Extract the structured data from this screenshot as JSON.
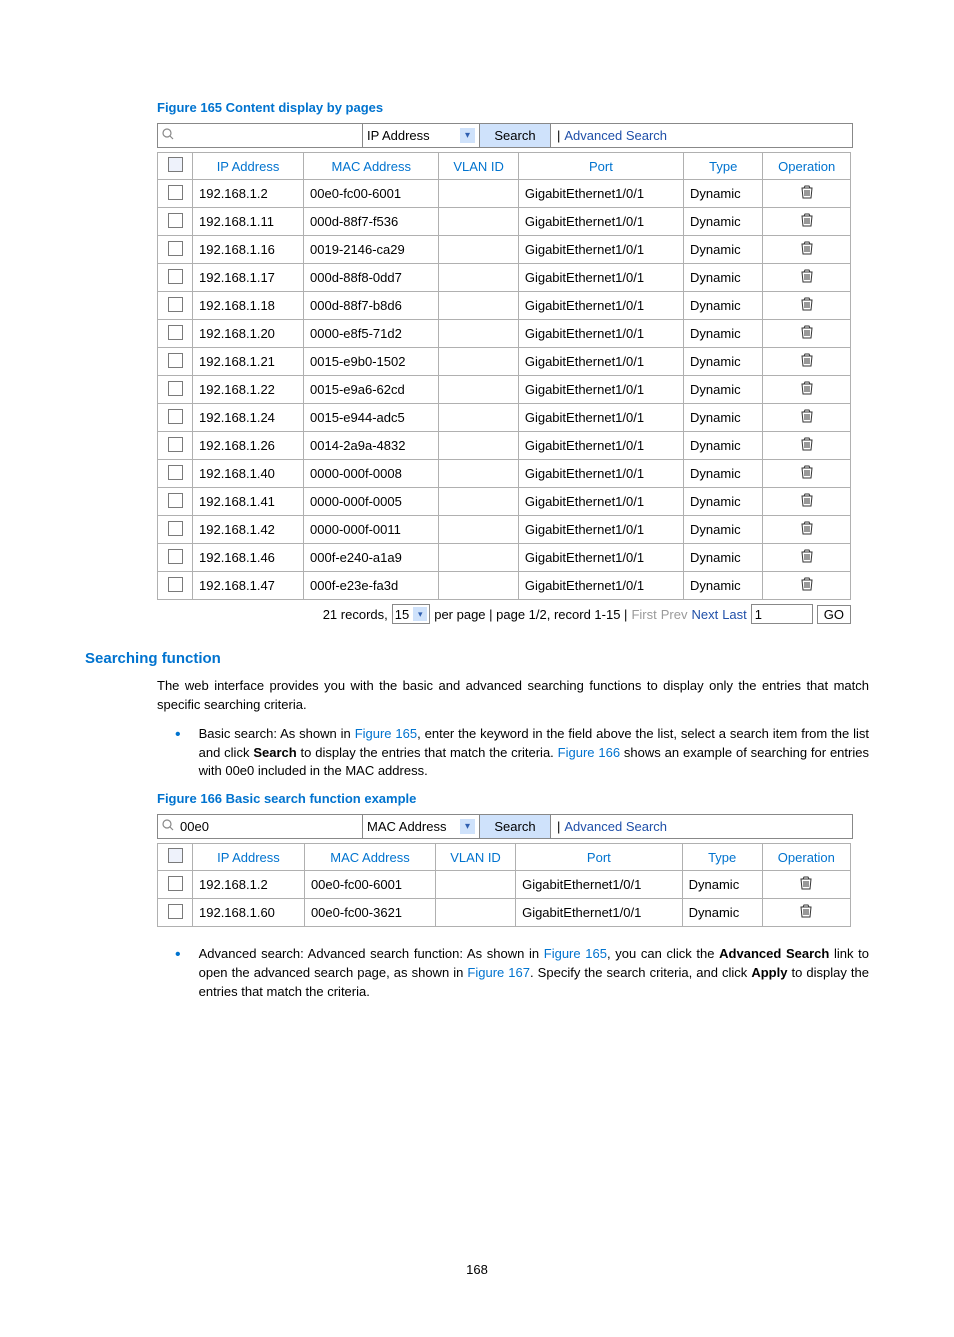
{
  "figure165": {
    "caption": "Figure 165 Content display by pages",
    "search": {
      "query": "",
      "select_label": "IP Address",
      "button": "Search",
      "advanced": "Advanced Search"
    },
    "headers": [
      "IP Address",
      "MAC Address",
      "VLAN ID",
      "Port",
      "Type",
      "Operation"
    ],
    "rows": [
      {
        "ip": "192.168.1.2",
        "mac": "00e0-fc00-6001",
        "vlan": "",
        "port": "GigabitEthernet1/0/1",
        "type": "Dynamic"
      },
      {
        "ip": "192.168.1.11",
        "mac": "000d-88f7-f536",
        "vlan": "",
        "port": "GigabitEthernet1/0/1",
        "type": "Dynamic"
      },
      {
        "ip": "192.168.1.16",
        "mac": "0019-2146-ca29",
        "vlan": "",
        "port": "GigabitEthernet1/0/1",
        "type": "Dynamic"
      },
      {
        "ip": "192.168.1.17",
        "mac": "000d-88f8-0dd7",
        "vlan": "",
        "port": "GigabitEthernet1/0/1",
        "type": "Dynamic"
      },
      {
        "ip": "192.168.1.18",
        "mac": "000d-88f7-b8d6",
        "vlan": "",
        "port": "GigabitEthernet1/0/1",
        "type": "Dynamic"
      },
      {
        "ip": "192.168.1.20",
        "mac": "0000-e8f5-71d2",
        "vlan": "",
        "port": "GigabitEthernet1/0/1",
        "type": "Dynamic"
      },
      {
        "ip": "192.168.1.21",
        "mac": "0015-e9b0-1502",
        "vlan": "",
        "port": "GigabitEthernet1/0/1",
        "type": "Dynamic"
      },
      {
        "ip": "192.168.1.22",
        "mac": "0015-e9a6-62cd",
        "vlan": "",
        "port": "GigabitEthernet1/0/1",
        "type": "Dynamic"
      },
      {
        "ip": "192.168.1.24",
        "mac": "0015-e944-adc5",
        "vlan": "",
        "port": "GigabitEthernet1/0/1",
        "type": "Dynamic"
      },
      {
        "ip": "192.168.1.26",
        "mac": "0014-2a9a-4832",
        "vlan": "",
        "port": "GigabitEthernet1/0/1",
        "type": "Dynamic"
      },
      {
        "ip": "192.168.1.40",
        "mac": "0000-000f-0008",
        "vlan": "",
        "port": "GigabitEthernet1/0/1",
        "type": "Dynamic"
      },
      {
        "ip": "192.168.1.41",
        "mac": "0000-000f-0005",
        "vlan": "",
        "port": "GigabitEthernet1/0/1",
        "type": "Dynamic"
      },
      {
        "ip": "192.168.1.42",
        "mac": "0000-000f-0011",
        "vlan": "",
        "port": "GigabitEthernet1/0/1",
        "type": "Dynamic"
      },
      {
        "ip": "192.168.1.46",
        "mac": "000f-e240-a1a9",
        "vlan": "",
        "port": "GigabitEthernet1/0/1",
        "type": "Dynamic"
      },
      {
        "ip": "192.168.1.47",
        "mac": "000f-e23e-fa3d",
        "vlan": "",
        "port": "GigabitEthernet1/0/1",
        "type": "Dynamic"
      }
    ],
    "pager": {
      "records_prefix": "21 records,",
      "per_page_value": "15",
      "per_page_suffix": "per page | page 1/2, record 1-15 |",
      "first": "First",
      "prev": "Prev",
      "next": "Next",
      "last": "Last",
      "page_input": "1",
      "go": "GO"
    }
  },
  "section": {
    "title": "Searching function",
    "para1": "The web interface provides you with the basic and advanced searching functions to display only the entries that match specific searching criteria.",
    "bullet1_a": "Basic search: As shown in ",
    "bullet1_link1": "Figure 165",
    "bullet1_b": ", enter the keyword in the field above the list, select a search item from the list and click ",
    "bullet1_bold1": "Search",
    "bullet1_c": " to display the entries that match the criteria. ",
    "bullet1_link2": "Figure 166",
    "bullet1_d": " shows an example of searching for entries with 00e0 included in the MAC address.",
    "bullet2_a": "Advanced search: Advanced search function: As shown in ",
    "bullet2_link1": "Figure 165",
    "bullet2_b": ", you can click the ",
    "bullet2_bold1": "Advanced Search",
    "bullet2_c": " link to open the advanced search page, as shown in ",
    "bullet2_link2": "Figure 167",
    "bullet2_d": ". Specify the search criteria, and click ",
    "bullet2_bold2": "Apply",
    "bullet2_e": " to display the entries that match the criteria."
  },
  "figure166": {
    "caption": "Figure 166 Basic search function example",
    "search": {
      "query": "00e0",
      "select_label": "MAC Address",
      "button": "Search",
      "advanced": "Advanced Search"
    },
    "headers": [
      "IP Address",
      "MAC Address",
      "VLAN ID",
      "Port",
      "Type",
      "Operation"
    ],
    "rows": [
      {
        "ip": "192.168.1.2",
        "mac": "00e0-fc00-6001",
        "vlan": "",
        "port": "GigabitEthernet1/0/1",
        "type": "Dynamic"
      },
      {
        "ip": "192.168.1.60",
        "mac": "00e0-fc00-3621",
        "vlan": "",
        "port": "GigabitEthernet1/0/1",
        "type": "Dynamic"
      }
    ]
  },
  "page_number": "168"
}
